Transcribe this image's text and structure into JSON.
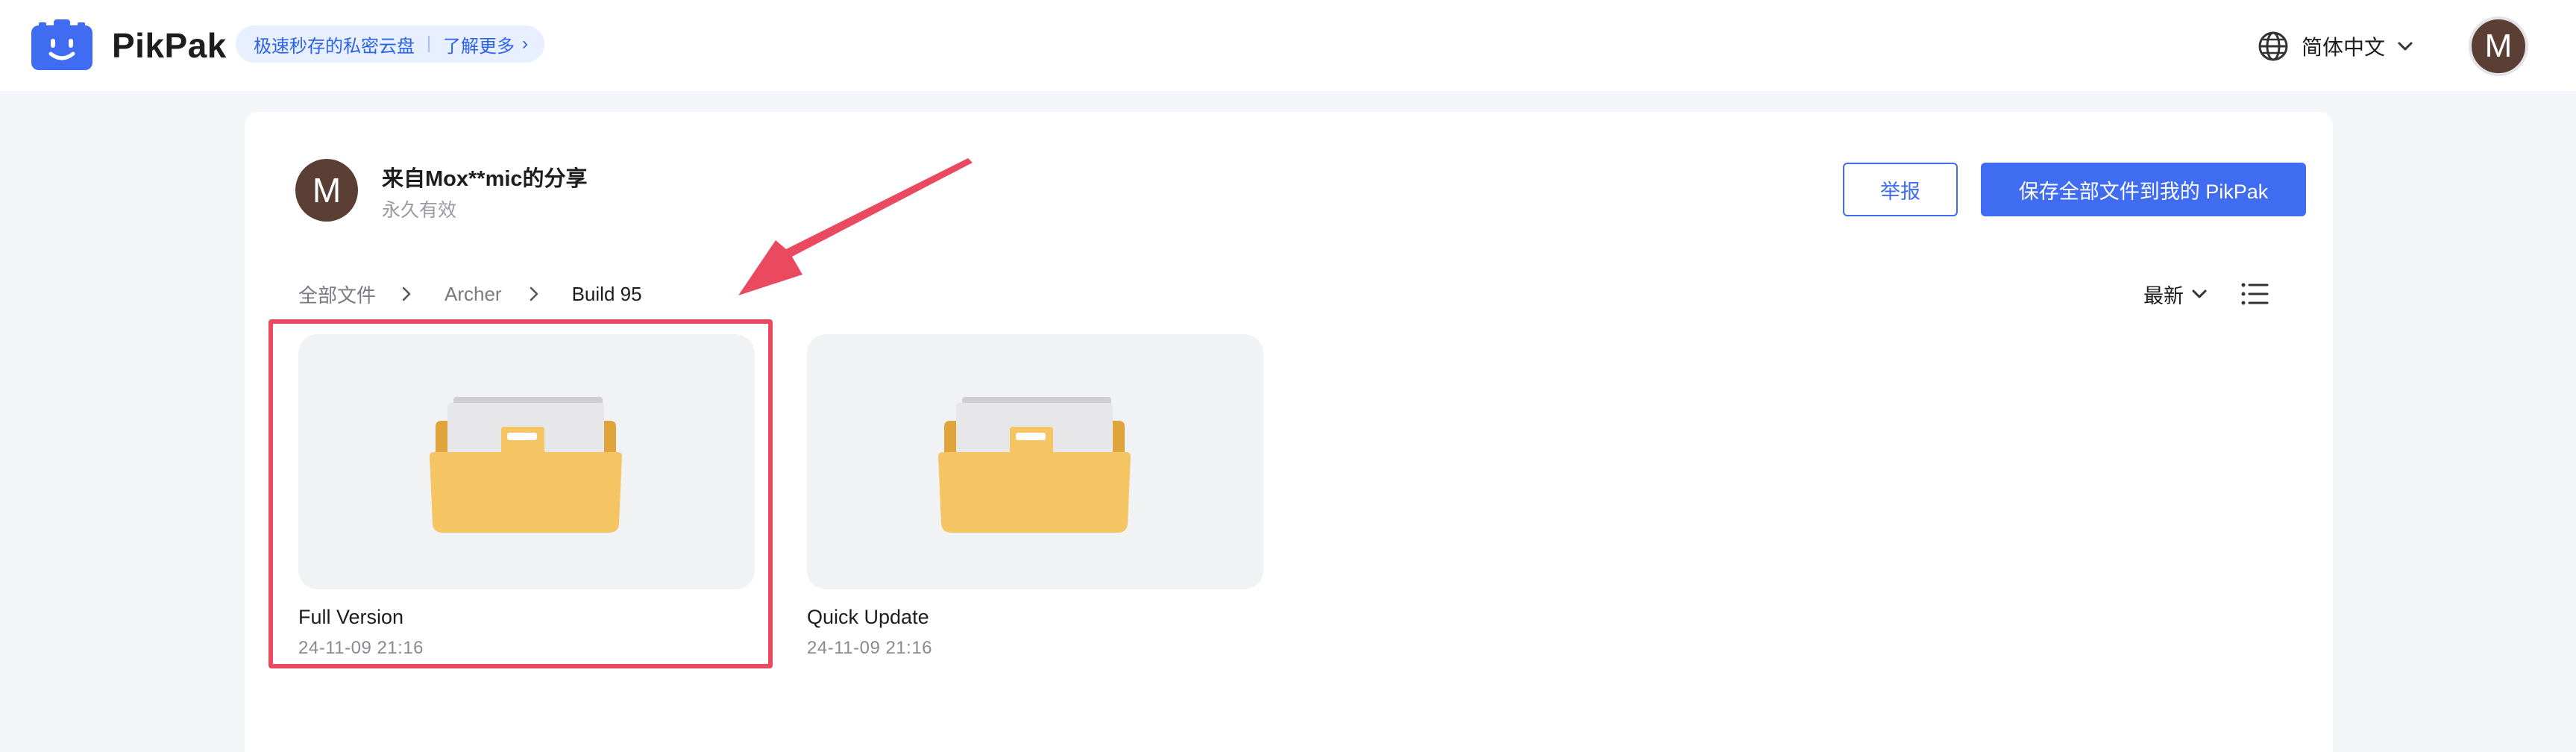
{
  "brand": {
    "name": "PikPak",
    "promo_text": "极速秒存的私密云盘",
    "promo_link": "了解更多",
    "accent": "#3f6cf0"
  },
  "header": {
    "language": "简体中文",
    "avatar_initial": "M"
  },
  "share": {
    "avatar_initial": "M",
    "title": "来自Mox**mic的分享",
    "validity": "永久有效",
    "report_label": "举报",
    "save_all_label": "保存全部文件到我的 PikPak"
  },
  "breadcrumb": {
    "items": [
      "全部文件",
      "Archer",
      "Build 95"
    ]
  },
  "toolbar": {
    "sort_label": "最新"
  },
  "files": [
    {
      "name": "Full Version",
      "date": "24-11-09 21:16",
      "icon": "folder-icon",
      "highlighted": true
    },
    {
      "name": "Quick Update",
      "date": "24-11-09 21:16",
      "icon": "folder-icon",
      "highlighted": false
    }
  ],
  "annotation": {
    "color": "#ea4a5f"
  }
}
